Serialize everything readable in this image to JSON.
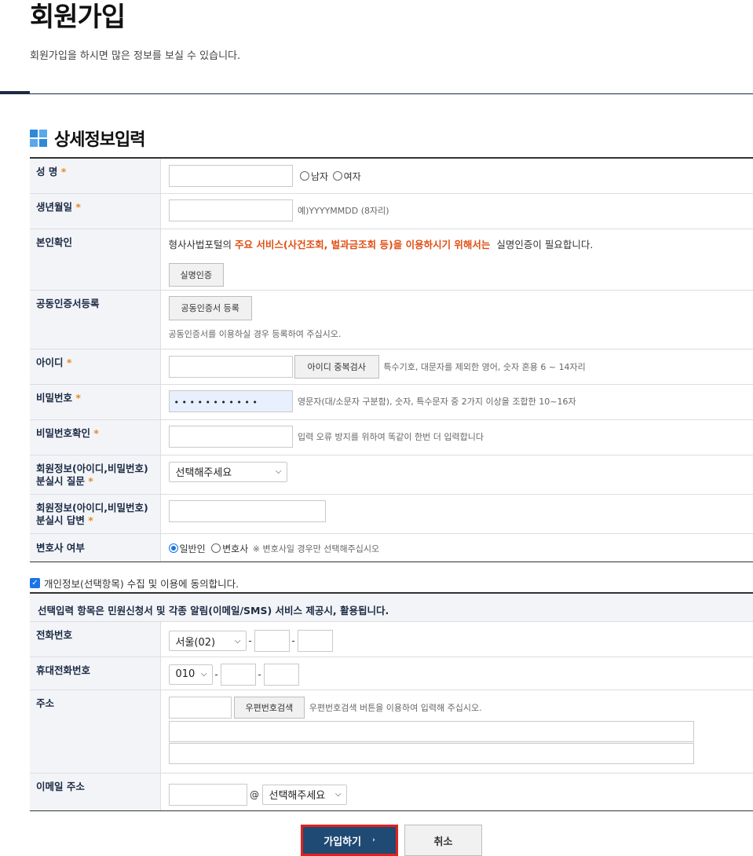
{
  "header": {
    "title": "회원가입",
    "description": "회원가입을 하시면 많은 정보를 보실 수 있습니다."
  },
  "section": {
    "title": "상세정보입력"
  },
  "required_mark": "*",
  "fields": {
    "name": {
      "label": "성 명",
      "gender_male": "남자",
      "gender_female": "여자"
    },
    "birth": {
      "label": "생년월일",
      "hint": "예)YYYYMMDD (8자리)"
    },
    "verify": {
      "label": "본인확인",
      "text_before": "형사사법포털의",
      "text_highlight": "주요 서비스(사건조회, 벌과금조회 등)을 이용하시기 위해서는",
      "text_after": "실명인증이 필요합니다.",
      "button": "실명인증"
    },
    "cert": {
      "label": "공동인증서등록",
      "button": "공동인증서 등록",
      "hint": "공동인증서를 이용하실 경우 등록하여 주십시오."
    },
    "userid": {
      "label": "아이디",
      "button": "아이디 중복검사",
      "hint": "특수기호, 대문자를 제외한 영어, 숫자 혼용 6 ~ 14자리"
    },
    "password": {
      "label": "비밀번호",
      "value": "•  •  •  •  •  •  •  •  •  •  •",
      "hint": "영문자(대/소문자 구분함), 숫자, 특수문자 중 2가지 이상을 조합한 10~16자"
    },
    "password_confirm": {
      "label": "비밀번호확인",
      "hint": "입력 오류 방지를 위하여 똑같이 한번 더 입력합니다"
    },
    "question": {
      "label_line1": "회원정보(아이디,비밀번호)",
      "label_line2": "분실시 질문",
      "select": "선택해주세요"
    },
    "answer": {
      "label_line1": "회원정보(아이디,비밀번호)",
      "label_line2": "분실시 답변"
    },
    "lawyer": {
      "label": "변호사 여부",
      "opt_general": "일반인",
      "opt_lawyer": "변호사",
      "note": "※ 변호사일 경우만 선택해주십시오"
    }
  },
  "agree": {
    "label": "개인정보(선택항목) 수집 및 이용에 동의합니다.",
    "checked": true
  },
  "optional_bar": "선택입력 항목은 민원신청서 및 각종 알림(이메일/SMS) 서비스 제공시, 활용됩니다.",
  "optional": {
    "phone": {
      "label": "전화번호",
      "area": "서울(02)"
    },
    "mobile": {
      "label": "휴대전화번호",
      "prefix": "010"
    },
    "address": {
      "label": "주소",
      "button": "우편번호검색",
      "hint": "우편번호검색 버튼을 이용하여 입력해 주십시오."
    },
    "email": {
      "label": "이메일 주소",
      "at": "@",
      "domain_select": "선택해주세요"
    }
  },
  "dash": "-",
  "buttons": {
    "join": "가입하기",
    "join_arrow": "›",
    "cancel": "취소"
  },
  "colors": {
    "navy": "#1b2b44",
    "highlight": "#e04e12",
    "required": "#e58a1f",
    "join_bg": "#1f4a73",
    "join_border": "#e2211c"
  }
}
